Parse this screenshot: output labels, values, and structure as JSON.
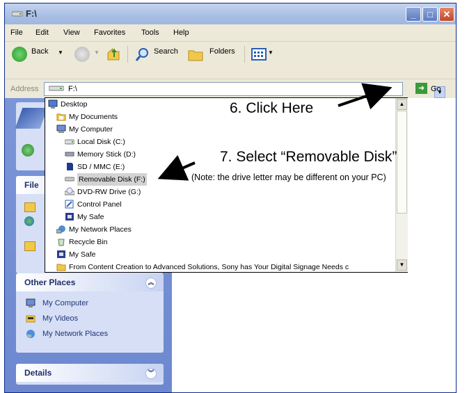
{
  "window": {
    "title": "F:\\",
    "controls": {
      "minimize": "_",
      "maximize": "□",
      "close": "✕"
    }
  },
  "menu": [
    "File",
    "Edit",
    "View",
    "Favorites",
    "Tools",
    "Help"
  ],
  "toolbar": {
    "back": "Back",
    "search": "Search",
    "folders": "Folders"
  },
  "address": {
    "label": "Address",
    "value": "F:\\",
    "go": "Go"
  },
  "dropdown": {
    "items": [
      {
        "label": "Desktop",
        "icon": "desktop-icon"
      },
      {
        "label": "My Documents",
        "icon": "folder-icon"
      },
      {
        "label": "My Computer",
        "icon": "computer-icon"
      },
      {
        "label": "Local Disk (C:)",
        "icon": "drive-icon"
      },
      {
        "label": "Memory Stick (D:)",
        "icon": "memory-stick-icon"
      },
      {
        "label": "SD / MMC (E:)",
        "icon": "sd-card-icon"
      },
      {
        "label": "Removable Disk (F:)",
        "icon": "removable-disk-icon",
        "selected": true
      },
      {
        "label": "DVD-RW Drive (G:)",
        "icon": "dvd-drive-icon"
      },
      {
        "label": "Control Panel",
        "icon": "control-panel-icon"
      },
      {
        "label": "My Safe",
        "icon": "safe-icon"
      },
      {
        "label": "My Network Places",
        "icon": "network-icon"
      },
      {
        "label": "Recycle Bin",
        "icon": "recycle-bin-icon"
      },
      {
        "label": "My Safe",
        "icon": "safe-icon"
      },
      {
        "label": "From Content Creation to Advanced Solutions, Sony has Your Digital Signage Needs c",
        "icon": "folder-icon"
      }
    ]
  },
  "left_pane": {
    "file_tasks_label": "File",
    "other_places": {
      "title": "Other Places",
      "items": [
        "My Computer",
        "My Videos",
        "My Network Places"
      ]
    },
    "details": {
      "title": "Details"
    }
  },
  "annotations": {
    "step6": "6. Click Here",
    "step7": "7. Select “Removable Disk”",
    "note": "(Note: the drive letter may be different on your PC)"
  },
  "colors": {
    "titlebar": "#a9bfe4",
    "left_pane": "#6d88cf",
    "selected_item": "#d3d3d3"
  }
}
